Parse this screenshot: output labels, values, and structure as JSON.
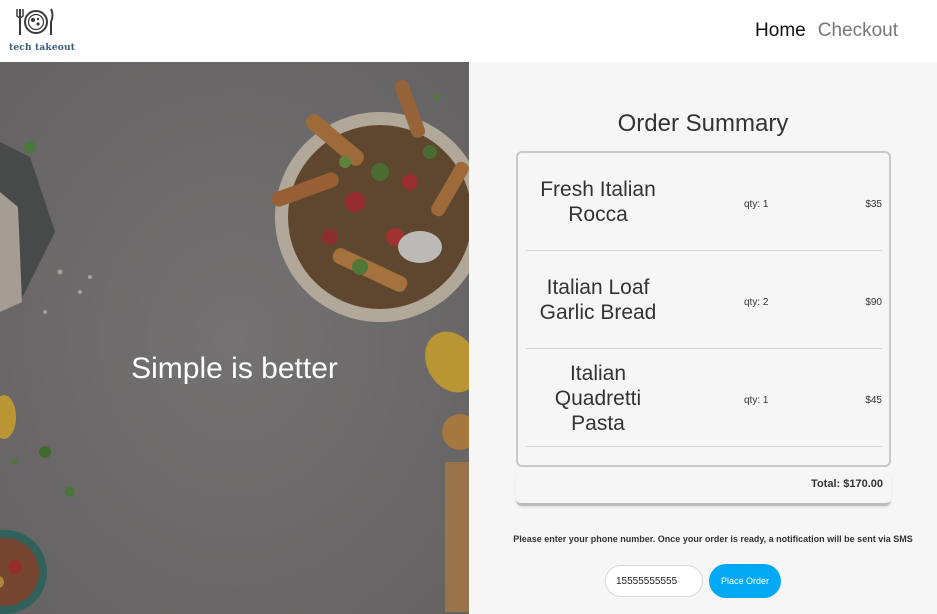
{
  "brand": {
    "logo_text": "tech takeout",
    "logo_color": "#3b5a78"
  },
  "nav": {
    "home": "Home",
    "checkout": "Checkout"
  },
  "hero": {
    "title": "Simple is better"
  },
  "order": {
    "title": "Order Summary",
    "items": [
      {
        "name": "Fresh Italian Rocca",
        "qty": "qty: 1",
        "price": "$35"
      },
      {
        "name": "Italian Loaf Garlic Bread",
        "qty": "qty: 2",
        "price": "$90"
      },
      {
        "name": "Italian Quadretti Pasta",
        "qty": "qty: 1",
        "price": "$45"
      }
    ],
    "total": "Total: $170.00"
  },
  "phone": {
    "note": "Please enter your phone number. Once your order is ready, a notification will be sent via SMS",
    "value": "15555555555"
  },
  "actions": {
    "place_order": "Place Order"
  },
  "colors": {
    "accent": "#03a9f4",
    "panel_bg": "#f6f6f6"
  }
}
